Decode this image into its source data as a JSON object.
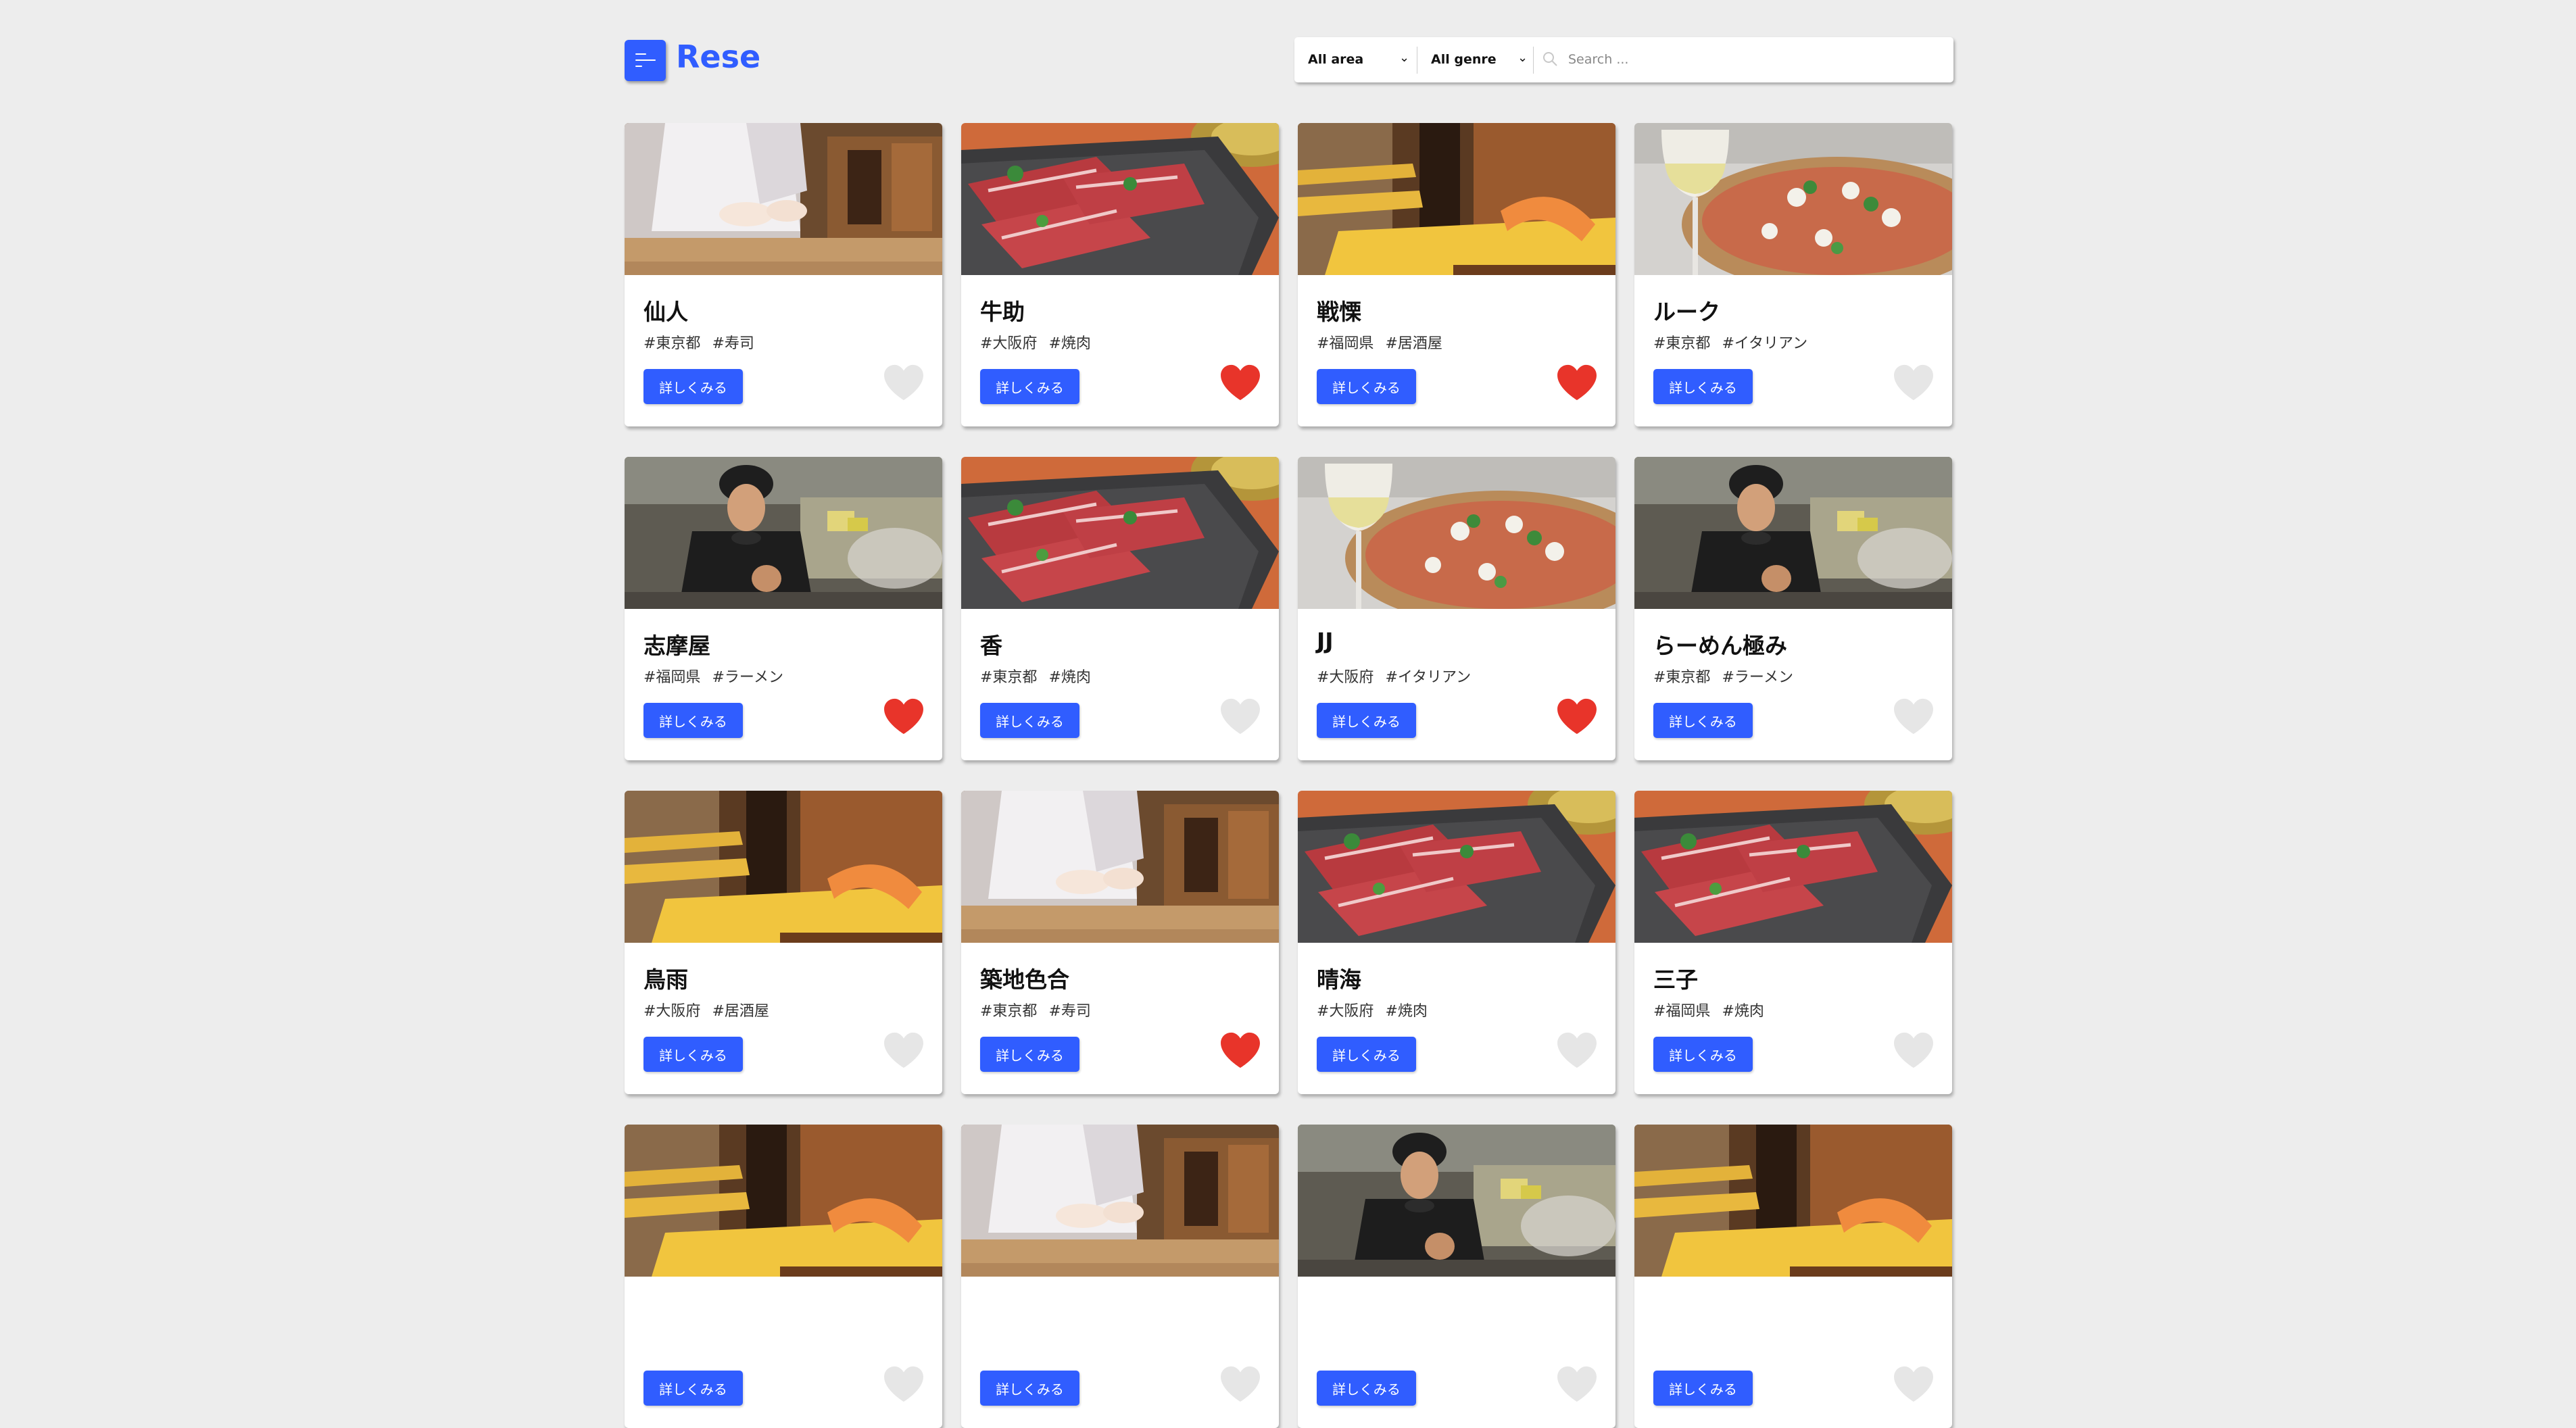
{
  "header": {
    "logo": "Rese",
    "area_select": "All area",
    "genre_select": "All genre",
    "search_placeholder": "Search ..."
  },
  "colors": {
    "accent": "#305dff",
    "heart_on": "#e8342a",
    "heart_off": "#e6e6e6"
  },
  "detail_label": "詳しくみる",
  "shops": [
    {
      "name": "仙人",
      "area": "#東京都",
      "genre": "#寿司",
      "liked": false,
      "photo": "sushi-chef"
    },
    {
      "name": "牛助",
      "area": "#大阪府",
      "genre": "#焼肉",
      "liked": true,
      "photo": "yakiniku"
    },
    {
      "name": "戦慄",
      "area": "#福岡県",
      "genre": "#居酒屋",
      "liked": true,
      "photo": "izakaya-tables"
    },
    {
      "name": "ルーク",
      "area": "#東京都",
      "genre": "#イタリアン",
      "liked": false,
      "photo": "pizza-wine"
    },
    {
      "name": "志摩屋",
      "area": "#福岡県",
      "genre": "#ラーメン",
      "liked": true,
      "photo": "ramen-chef"
    },
    {
      "name": "香",
      "area": "#東京都",
      "genre": "#焼肉",
      "liked": false,
      "photo": "yakiniku"
    },
    {
      "name": "JJ",
      "area": "#大阪府",
      "genre": "#イタリアン",
      "liked": true,
      "photo": "pizza-wine"
    },
    {
      "name": "らーめん極み",
      "area": "#東京都",
      "genre": "#ラーメン",
      "liked": false,
      "photo": "ramen-chef"
    },
    {
      "name": "鳥雨",
      "area": "#大阪府",
      "genre": "#居酒屋",
      "liked": false,
      "photo": "izakaya-tables"
    },
    {
      "name": "築地色合",
      "area": "#東京都",
      "genre": "#寿司",
      "liked": true,
      "photo": "sushi-chef"
    },
    {
      "name": "晴海",
      "area": "#大阪府",
      "genre": "#焼肉",
      "liked": false,
      "photo": "yakiniku"
    },
    {
      "name": "三子",
      "area": "#福岡県",
      "genre": "#焼肉",
      "liked": false,
      "photo": "yakiniku"
    },
    {
      "name": "",
      "area": "",
      "genre": "",
      "liked": false,
      "photo": "izakaya-tables"
    },
    {
      "name": "",
      "area": "",
      "genre": "",
      "liked": false,
      "photo": "sushi-chef"
    },
    {
      "name": "",
      "area": "",
      "genre": "",
      "liked": false,
      "photo": "ramen-chef"
    },
    {
      "name": "",
      "area": "",
      "genre": "",
      "liked": false,
      "photo": "izakaya-tables"
    }
  ]
}
